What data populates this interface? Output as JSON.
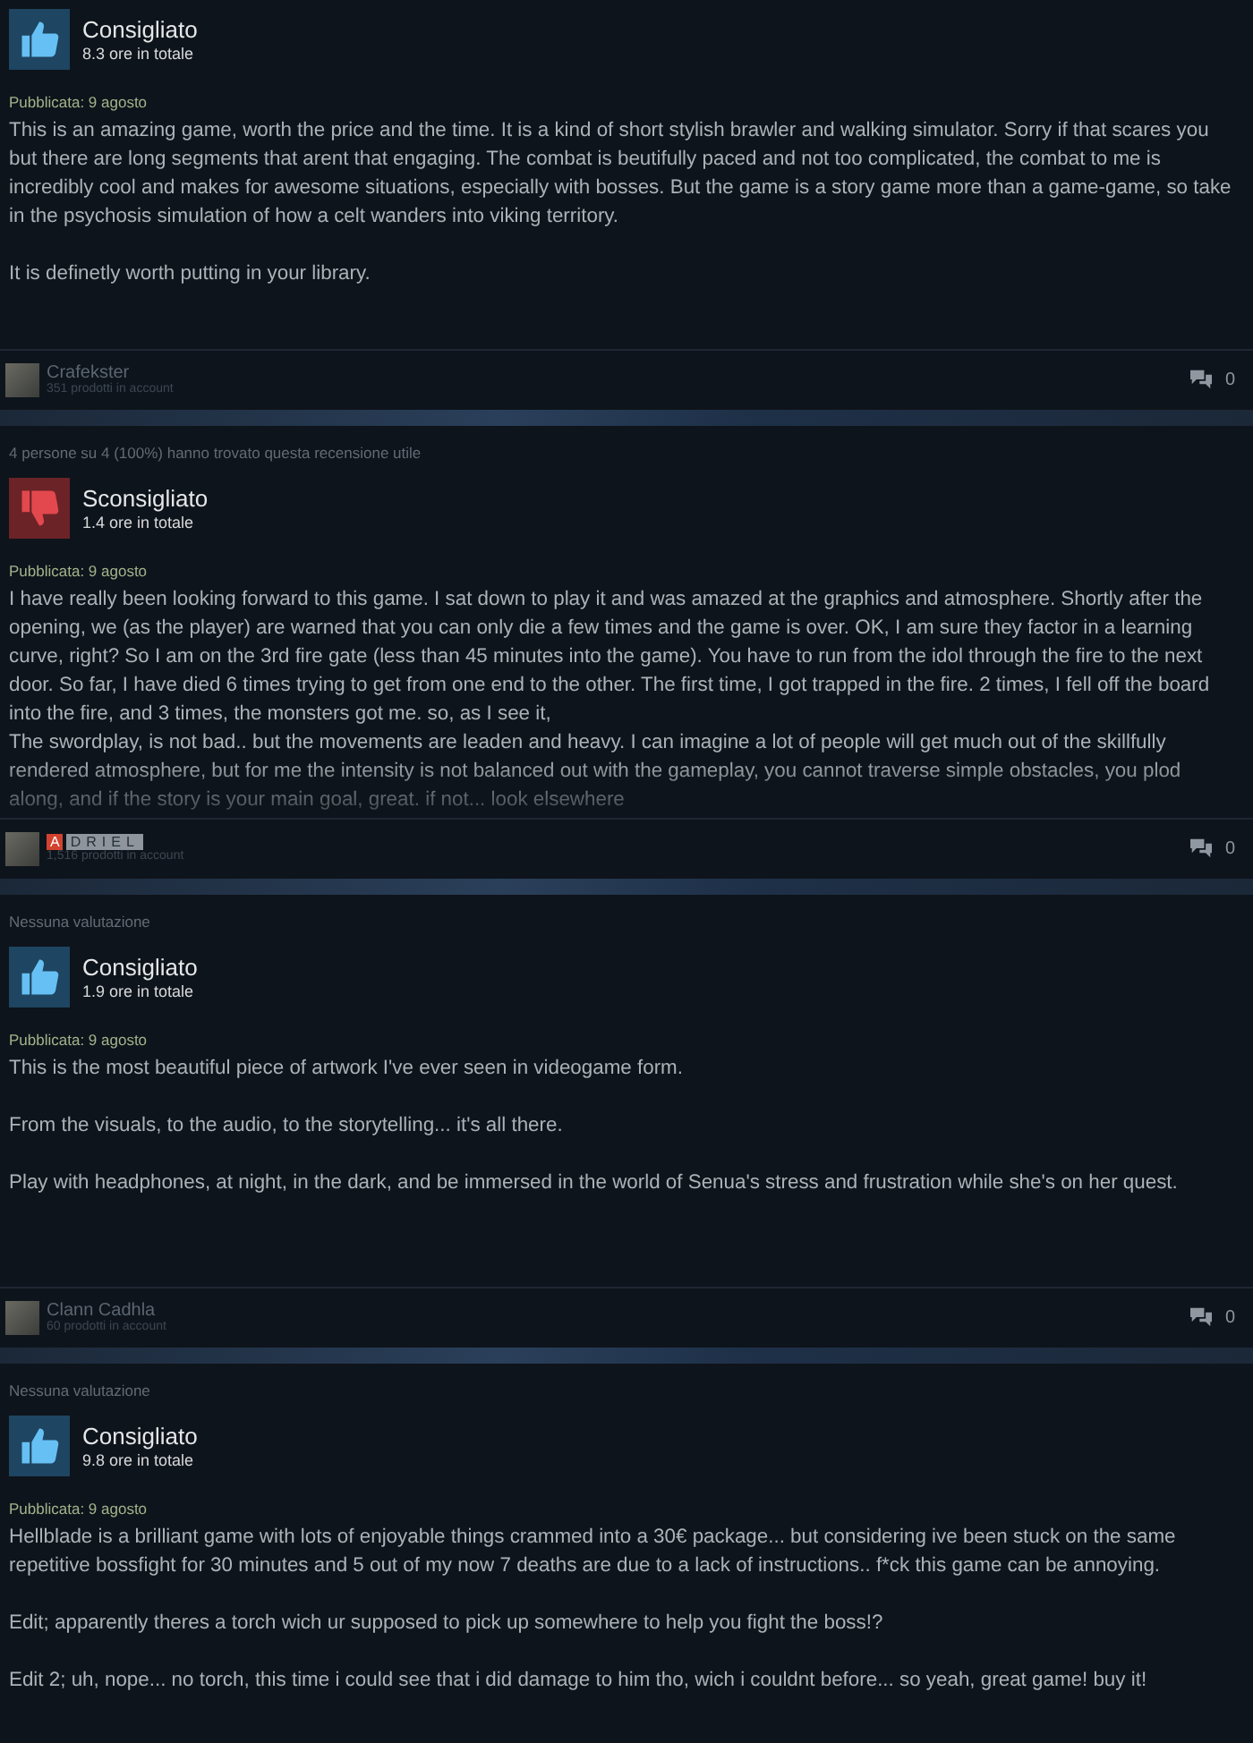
{
  "reviews": [
    {
      "verdict": {
        "kind": "recommended",
        "label": "Consigliato"
      },
      "hours": "8.3 ore in totale",
      "posted": "Pubblicata: 9 agosto",
      "paragraphs": [
        "This is an amazing game, worth the price and the time. It is a kind of short stylish brawler and walking simulator. Sorry if that scares you but there are long segments that arent that engaging. The combat is beutifully paced and not too complicated, the combat to me is incredibly cool and makes for awesome situations, especially with bosses. But the game is a story game more than a game-game, so take in the psychosis simulation of how a celt wanders into viking territory.",
        "It is definetly worth putting in your library."
      ],
      "truncated": false,
      "author": {
        "name": "Crafekster",
        "products": "351 prodotti in account",
        "comments": "0"
      }
    },
    {
      "helpful": "4 persone su 4 (100%) hanno trovato questa recensione utile",
      "verdict": {
        "kind": "not_recommended",
        "label": "Sconsigliato"
      },
      "hours": "1.4 ore in totale",
      "posted": "Pubblicata: 9 agosto",
      "paragraphs": [
        "I have really been looking forward to this game. I sat down to play it and was amazed at the graphics and atmosphere. Shortly after the opening, we (as the player) are warned that you can only die a few times and the game is over. OK, I am sure they factor in a learning curve, right? So I am on the 3rd fire gate (less than 45 minutes into the game). You have to run from the idol through the fire to the next door. So far, I have died 6 times trying to get from one end to the other. The first time, I got trapped in the fire. 2 times, I fell off the board into the fire, and 3 times, the monsters got me. so, as I see it,\nThe swordplay, is not bad.. but the movements are leaden and heavy. I can imagine a lot of people will get much out of the skillfully rendered atmosphere, but for me the intensity is not balanced out with the gameplay, you cannot traverse simple obstacles, you plod along, and if the story is your main goal, great. if not... look elsewhere"
      ],
      "truncated": true,
      "author": {
        "badge": "A",
        "name": "DRIEL",
        "products": "1,516 prodotti in account",
        "comments": "0"
      }
    },
    {
      "helpful": "Nessuna valutazione",
      "verdict": {
        "kind": "recommended",
        "label": "Consigliato"
      },
      "hours": "1.9 ore in totale",
      "posted": "Pubblicata: 9 agosto",
      "paragraphs": [
        "This is the most beautiful piece of artwork I've ever seen in videogame form.",
        "From the visuals, to the audio, to the storytelling... it's all there.",
        "Play with headphones, at night, in the dark, and be immersed in the world of Senua's stress and frustration while she's on her quest."
      ],
      "truncated": false,
      "author": {
        "name": "Clann Cadhla",
        "products": "60 prodotti in account",
        "comments": "0"
      }
    },
    {
      "helpful": "Nessuna valutazione",
      "verdict": {
        "kind": "recommended",
        "label": "Consigliato"
      },
      "hours": "9.8 ore in totale",
      "posted": "Pubblicata: 9 agosto",
      "paragraphs": [
        "Hellblade is a brilliant game with lots of enjoyable things crammed into a 30€ package... but considering ive been stuck on the same repetitive bossfight for 30 minutes and 5 out of my now 7 deaths are due to a lack of instructions.. f*ck this game can be annoying.",
        "Edit; apparently theres a torch wich ur supposed to pick up somewhere to help you fight the boss!?",
        "Edit 2; uh, nope... no torch, this time i could see that i did damage to him tho, wich i couldnt before... so yeah, great game! buy it!"
      ],
      "truncated": false
    }
  ]
}
